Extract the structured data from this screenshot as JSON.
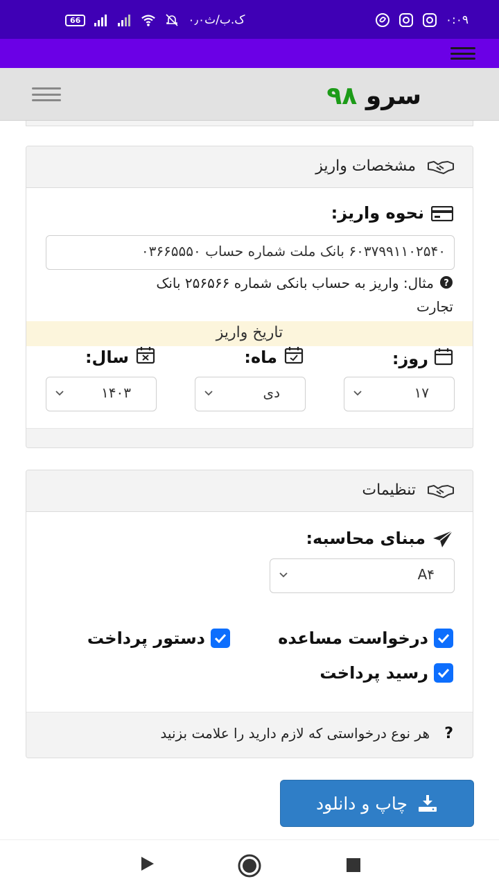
{
  "status_bar": {
    "time": "۰:۰۹",
    "network_text": "۰٫۰ک.ب/ث",
    "battery": "66"
  },
  "header": {
    "logo_text": "سرو",
    "logo_number": "۹۸"
  },
  "deposit_card": {
    "title": "مشخصات واریز",
    "method_label": "نحوه واریز:",
    "method_value": "۶۰۳۷۹۹۱۱۰۲۵۴۰ بانک ملت شماره حساب ۰۳۶۶۵۵۵۰",
    "example_line1": "مثال: واریز به حساب بانکی شماره ۲۵۶۵۶۶ بانک",
    "example_line2": "تجارت",
    "date_heading": "تاریخ واریز",
    "day_label": "روز:",
    "month_label": "ماه:",
    "year_label": "سال:",
    "day_value": "۱۷",
    "month_value": "دی",
    "year_value": "۱۴۰۳"
  },
  "settings_card": {
    "title": "تنظیمات",
    "basis_label": "مبنای محاسبه:",
    "basis_value": "A۴",
    "checkboxes": {
      "assistance_request": "درخواست مساعده",
      "payment_order": "دستور پرداخت",
      "payment_receipt": "رسید پرداخت"
    },
    "footer_hint": "هر نوع درخواستی که لازم دارید را علامت بزنید",
    "footer_icon_char": "?"
  },
  "actions": {
    "print_download_label": "چاپ و دانلود"
  },
  "colors": {
    "status_bar": "#3f00b5",
    "app_bar": "#6b00e6",
    "logo_green": "#1c9b18",
    "checkbox_blue": "#0d6efd",
    "primary_button": "#2f7ec7",
    "date_band": "#fcf5dc"
  }
}
